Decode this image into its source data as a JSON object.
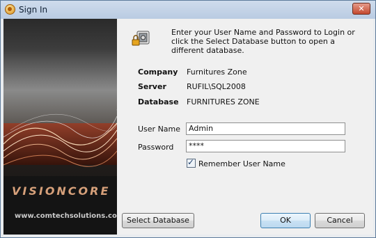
{
  "window": {
    "title": "Sign In",
    "close_label": "✕"
  },
  "banner": {
    "brand": "VISIONCORE",
    "url": "www.comtechsolutions.com"
  },
  "intro": "Enter your User Name and Password to Login or click the Select Database button to open a different database.",
  "info": {
    "company_label": "Company",
    "company_value": "Furnitures Zone",
    "server_label": "Server",
    "server_value": "RUFIL\\SQL2008",
    "database_label": "Database",
    "database_value": "FURNITURES ZONE"
  },
  "form": {
    "username_label": "User Name",
    "username_value": "Admin",
    "password_label": "Password",
    "password_value": "****",
    "remember_label": "Remember User Name",
    "remember_checked": true
  },
  "buttons": {
    "select_database": "Select Database",
    "ok": "OK",
    "cancel": "Cancel"
  }
}
